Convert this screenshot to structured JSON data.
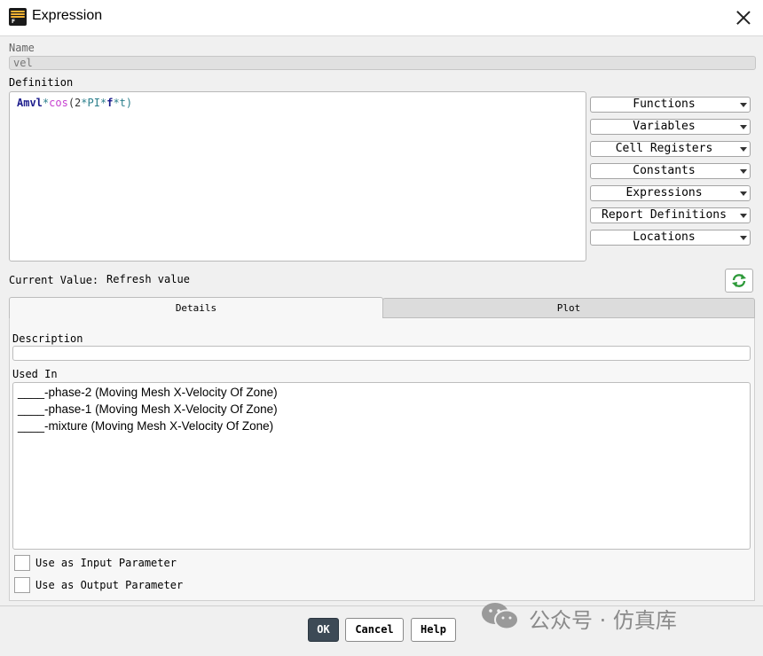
{
  "window": {
    "title": "Expression"
  },
  "name": {
    "label": "Name",
    "value": "vel"
  },
  "definition": {
    "label": "Definition",
    "tokens": [
      "Amvl",
      "*",
      "cos",
      "(2",
      "*",
      "PI",
      "*",
      "f",
      "*",
      "t)"
    ]
  },
  "menus": [
    {
      "label": "Functions"
    },
    {
      "label": "Variables"
    },
    {
      "label": "Cell Registers"
    },
    {
      "label": "Constants"
    },
    {
      "label": "Expressions"
    },
    {
      "label": "Report Definitions"
    },
    {
      "label": "Locations"
    }
  ],
  "current_value": {
    "label": "Current Value:",
    "value": "Refresh value"
  },
  "tabs": {
    "details": "Details",
    "plot": "Plot"
  },
  "description": {
    "label": "Description",
    "value": ""
  },
  "used_in": {
    "label": "Used In",
    "items": [
      "____-phase-2 (Moving Mesh X-Velocity Of Zone)",
      "____-phase-1 (Moving Mesh X-Velocity Of Zone)",
      "____-mixture (Moving Mesh X-Velocity Of Zone)"
    ]
  },
  "options": {
    "input_param": "Use as Input Parameter",
    "output_param": "Use as Output Parameter"
  },
  "buttons": {
    "ok": "OK",
    "cancel": "Cancel",
    "help": "Help"
  },
  "watermark": {
    "text": "公众号 · 仿真库"
  },
  "colors": {
    "ok_button": "#3d4a56",
    "refresh_icon": "#2e9a3a",
    "fn_token": "#c63fd0",
    "var_token": "#1c1c8c"
  }
}
